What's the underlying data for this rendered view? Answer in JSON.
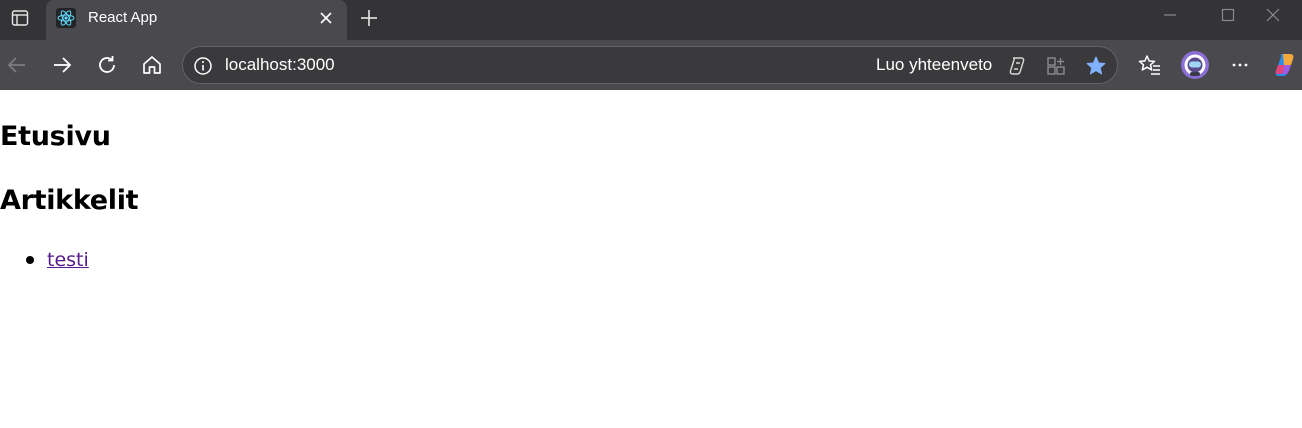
{
  "browser": {
    "tab": {
      "title": "React App",
      "favicon": "react-logo-icon"
    },
    "toolbar": {
      "url": "localhost:3000",
      "summary_label": "Luo yhteenveto"
    },
    "colors": {
      "titlebar": "#343437",
      "toolbar": "#4a4a4e",
      "favorite_star": "#7fb1ff"
    }
  },
  "page": {
    "heading": "Etusivu",
    "articles_heading": "Artikkelit",
    "articles": [
      {
        "title": "testi"
      }
    ],
    "link_color": "#551a8b"
  }
}
